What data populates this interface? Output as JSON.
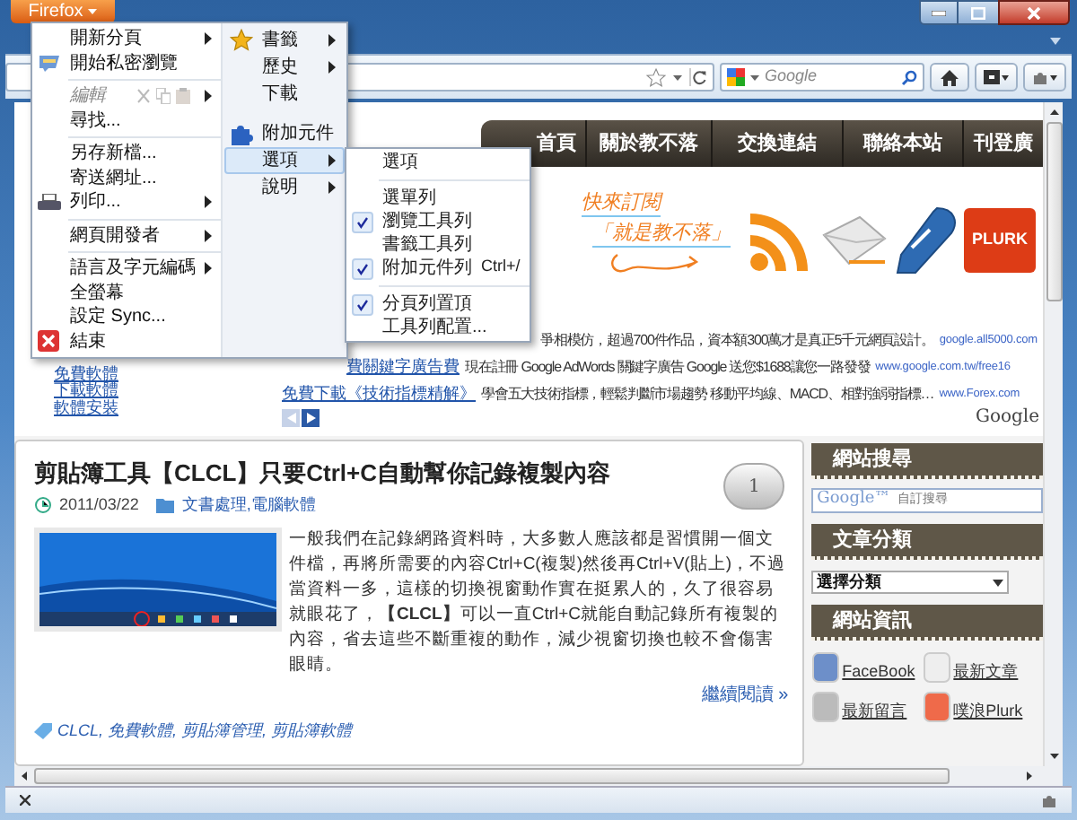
{
  "window": {
    "button": "Firefox"
  },
  "toolbar": {
    "search": {
      "placeholder": "Google"
    }
  },
  "site_nav": [
    "首頁",
    "關於教不落",
    "交換連結",
    "聯絡本站",
    "刊登廣"
  ],
  "side_links": [
    "免費軟體",
    "下載軟體",
    "軟體安裝"
  ],
  "subscribe": {
    "line_1": "快來訂閱",
    "line_2": "「就是教不落」",
    "badge": "PLURK"
  },
  "ads": [
    {
      "text": "爭相模仿，超過700件作品，資本額300萬才是真正5千元網頁設計。",
      "url": "google.all5000.com"
    },
    {
      "title": "費關鍵字廣告費",
      "text": "現在註冊 Google AdWords 關鍵字廣告 Google 送您$1688讓您一路發發",
      "url": "www.google.com.tw/free16"
    },
    {
      "title": "免費下載《技術指標精解》",
      "text": "學會五大技術指標，輕鬆判斷市場趨勢 移動平均線、MACD、相對強弱指標…",
      "url": "www.Forex.com"
    }
  ],
  "ads_by": "Google",
  "post": {
    "title": "剪貼簿工具【CLCL】只要Ctrl+C自動幫你記錄複製內容",
    "date": "2011/03/22",
    "category": "文書處理,電腦軟體",
    "comments": "1",
    "body": "一般我們在記錄網路資料時，大多數人應該都是習慣開一個文件檔，再將所需要的內容Ctrl+C(複製)然後再Ctrl+V(貼上)，不過當資料一多，這樣的切換視窗動作實在挺累人的，久了很容易就眼花了，**【CLCL】**可以一直Ctrl+C就能自動記錄所有複製的內容，省去這些不斷重複的動作，減少視窗切換也較不會傷害眼睛。",
    "read_more": "繼續閱讀 »",
    "tags": "CLCL, 免費軟體, 剪貼簿管理, 剪貼簿軟體"
  },
  "sidebar": {
    "search_title": "網站搜尋",
    "search_brand": "Google™",
    "search_placeholder": "自訂搜尋",
    "category_title": "文章分類",
    "category_select": "選擇分類",
    "info_title": "網站資訊",
    "info_links": [
      "FaceBook",
      "最新文章",
      "最新留言",
      "噗浪Plurk"
    ]
  },
  "menu": {
    "left": [
      {
        "kind": "item",
        "label": "開新分頁",
        "submenu": true,
        "disabled": false
      },
      {
        "kind": "item",
        "label": "開始私密瀏覽",
        "submenu": false,
        "disabled": false
      },
      {
        "kind": "separator"
      },
      {
        "kind": "item",
        "label": "編輯",
        "submenu": true,
        "disabled": true
      },
      {
        "kind": "item",
        "label": "尋找...",
        "submenu": false,
        "disabled": false
      },
      {
        "kind": "separator"
      },
      {
        "kind": "item",
        "label": "另存新檔...",
        "submenu": false,
        "disabled": false
      },
      {
        "kind": "item",
        "label": "寄送網址...",
        "submenu": false,
        "disabled": false
      },
      {
        "kind": "item",
        "label": "列印...",
        "submenu": true,
        "disabled": false
      },
      {
        "kind": "separator"
      },
      {
        "kind": "item",
        "label": "網頁開發者",
        "submenu": true,
        "disabled": false
      },
      {
        "kind": "separator"
      },
      {
        "kind": "item",
        "label": "語言及字元編碼",
        "submenu": true,
        "disabled": false
      },
      {
        "kind": "item",
        "label": "全螢幕",
        "submenu": false,
        "disabled": false
      },
      {
        "kind": "item",
        "label": "設定 Sync...",
        "submenu": false,
        "disabled": false
      },
      {
        "kind": "item",
        "label": "結束",
        "submenu": false,
        "disabled": false
      }
    ],
    "right": [
      {
        "kind": "item",
        "label": "書籤",
        "submenu": true,
        "selected": false
      },
      {
        "kind": "item",
        "label": "歷史",
        "submenu": true,
        "selected": false
      },
      {
        "kind": "item",
        "label": "下載",
        "submenu": false,
        "selected": false
      },
      {
        "kind": "gap"
      },
      {
        "kind": "item",
        "label": "附加元件",
        "submenu": false,
        "selected": false
      },
      {
        "kind": "item",
        "label": "選項",
        "submenu": true,
        "selected": true
      },
      {
        "kind": "item",
        "label": "說明",
        "submenu": true,
        "selected": false
      }
    ],
    "submenu": [
      {
        "kind": "item",
        "label": "選項",
        "checked": false
      },
      {
        "kind": "separator"
      },
      {
        "kind": "item",
        "label": "選單列",
        "checked": false
      },
      {
        "kind": "item",
        "label": "瀏覽工具列",
        "checked": true
      },
      {
        "kind": "item",
        "label": "書籤工具列",
        "checked": false
      },
      {
        "kind": "item",
        "label": "附加元件列",
        "checked": true,
        "shortcut": "Ctrl+/"
      },
      {
        "kind": "separator"
      },
      {
        "kind": "item",
        "label": "分頁列置頂",
        "checked": true
      },
      {
        "kind": "item",
        "label": "工具列配置...",
        "checked": false
      }
    ]
  }
}
